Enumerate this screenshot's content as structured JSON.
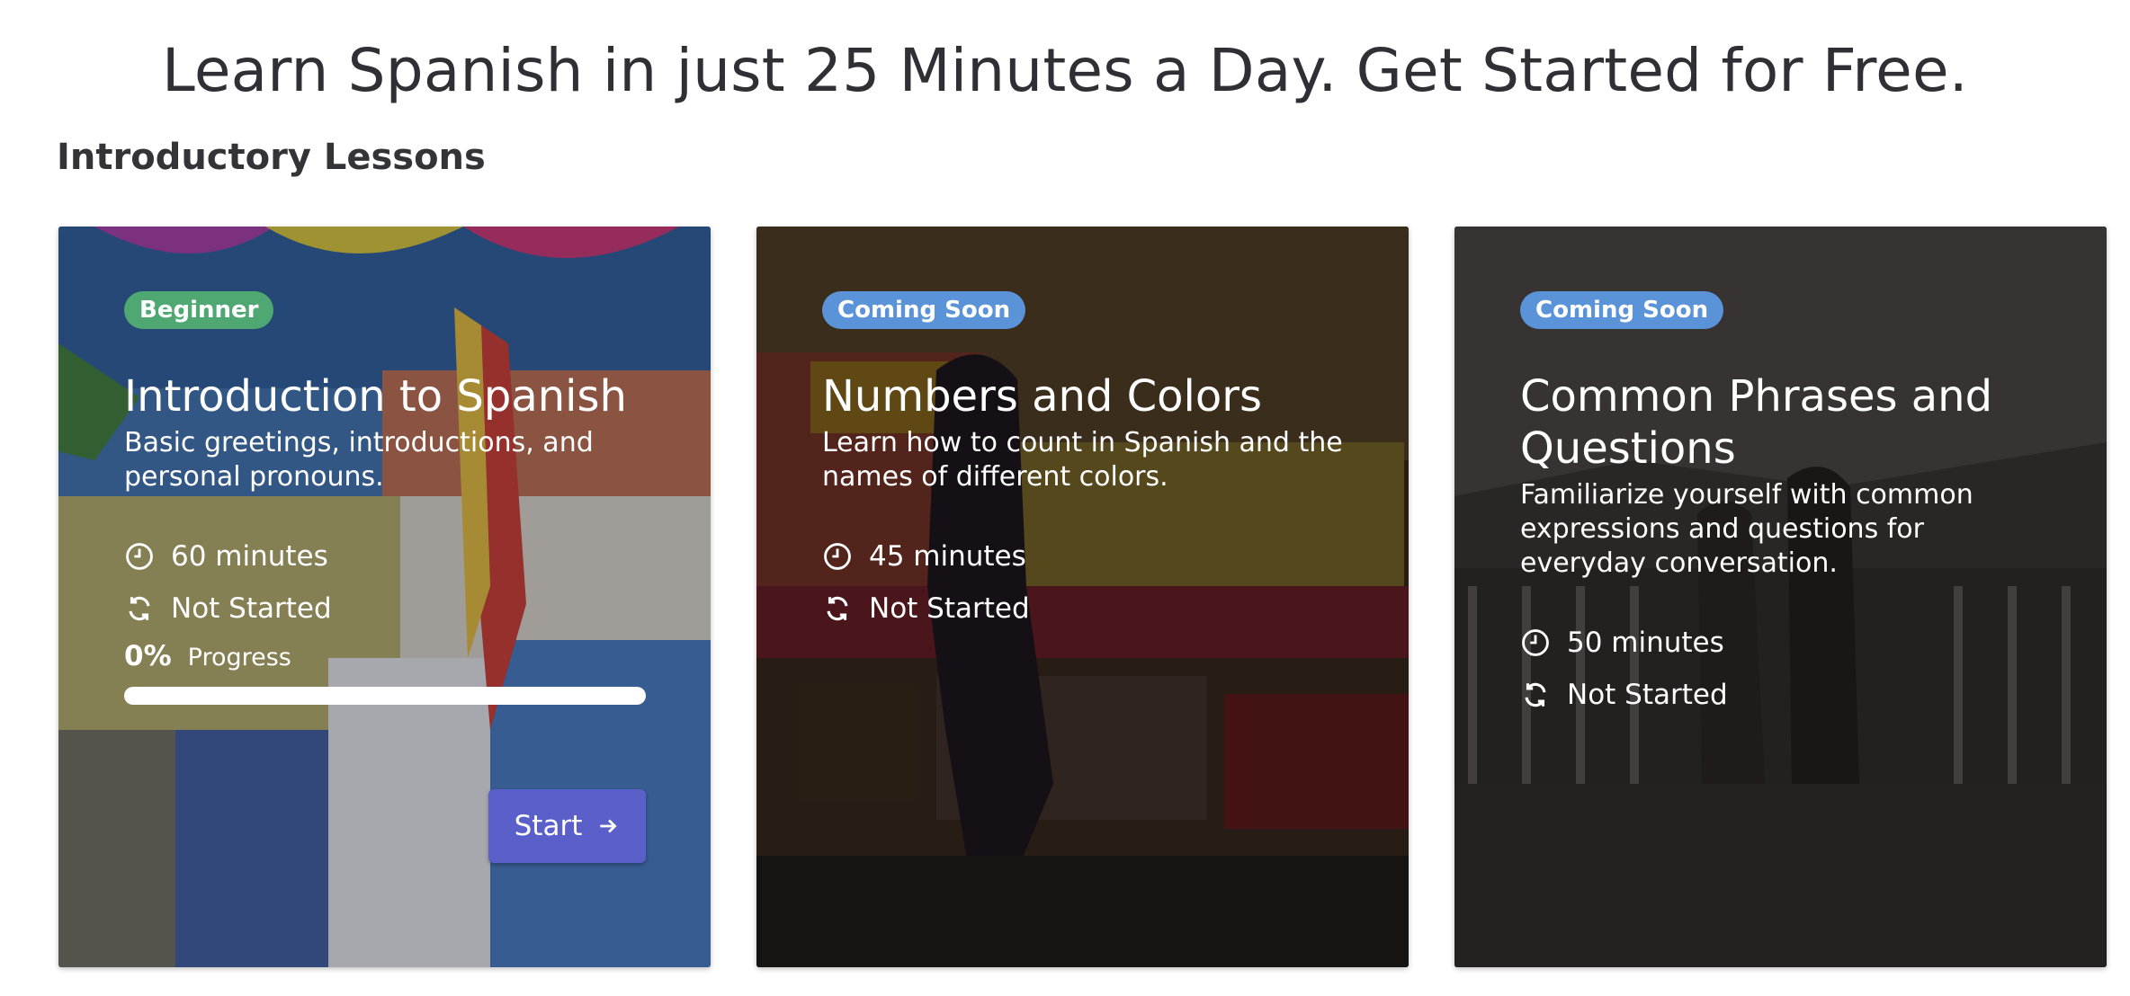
{
  "header": {
    "title": "Learn Spanish in just 25 Minutes a Day. Get Started for Free."
  },
  "section": {
    "title": "Introductory Lessons"
  },
  "cards": [
    {
      "badge": "Beginner",
      "badge_color": "#4fa872",
      "title": "Introduction to Spanish",
      "description": "Basic greetings, introductions, and personal pronouns.",
      "duration": "60 minutes",
      "status": "Not Started",
      "progress_value": "0%",
      "progress_label": "Progress",
      "progress_fraction": 0,
      "button_label": "Start",
      "icons": [
        "clock-icon",
        "sync-icon",
        "arrow-right-icon"
      ]
    },
    {
      "badge": "Coming Soon",
      "badge_color": "#5b93d9",
      "title": "Numbers and Colors",
      "description": "Learn how to count in Spanish and the names of different colors.",
      "duration": "45 minutes",
      "status": "Not Started",
      "icons": [
        "clock-icon",
        "sync-icon"
      ]
    },
    {
      "badge": "Coming Soon",
      "badge_color": "#5b93d9",
      "title": "Common Phrases and Questions",
      "description": "Familiarize yourself with common expressions and questions for everyday conversation.",
      "duration": "50 minutes",
      "status": "Not Started",
      "icons": [
        "clock-icon",
        "sync-icon"
      ]
    }
  ],
  "colors": {
    "button": "#5a5fc9",
    "badge_beginner": "#4fa872",
    "badge_coming_soon": "#5b93d9"
  }
}
